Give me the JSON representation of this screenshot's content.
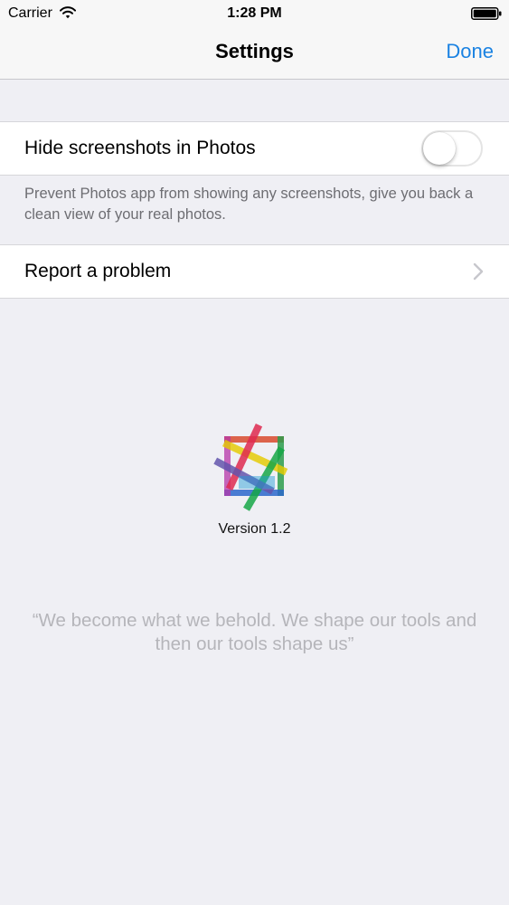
{
  "status_bar": {
    "carrier": "Carrier",
    "time": "1:28 PM",
    "icons": [
      "wifi-icon",
      "battery-icon"
    ]
  },
  "nav": {
    "title": "Settings",
    "done_label": "Done",
    "accent_color": "#1a82e2"
  },
  "settings": {
    "hide_screenshots": {
      "label": "Hide screenshots in Photos",
      "enabled": false,
      "footnote": "Prevent Photos app from showing any screenshots, give you back a clean view of your real photos."
    },
    "report_problem": {
      "label": "Report a problem",
      "icon": "chevron-right-icon"
    }
  },
  "about": {
    "logo_icon": "app-logo-icon",
    "version": "Version 1.2",
    "quote": "“We become what we behold. We shape our tools and then our tools shape us”"
  }
}
